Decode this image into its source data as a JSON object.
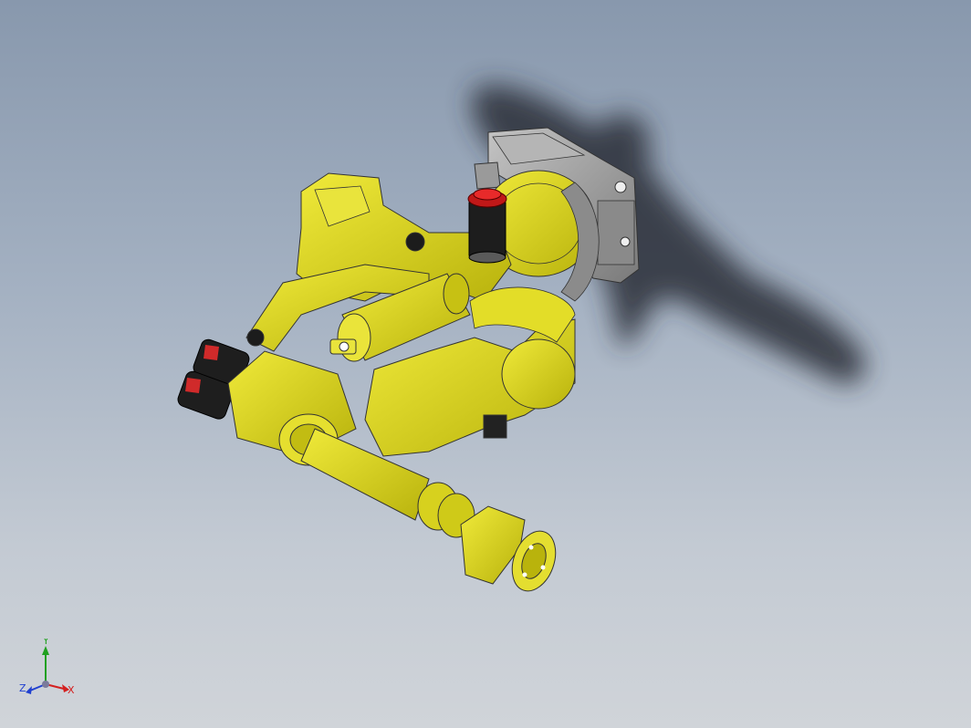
{
  "viewport": {
    "background_top": "#8898ad",
    "background_bottom": "#d0d4d9"
  },
  "model": {
    "body_color": "#d8d312",
    "shadow_color": "#2a2f37",
    "base_color": "#9c9c9c",
    "cap_color": "#d21a1a",
    "motor_color": "#222222"
  },
  "triad": {
    "x_label": "X",
    "y_label": "Y",
    "z_label": "Z",
    "x_color": "#d42020",
    "y_color": "#20a020",
    "z_color": "#2040d0"
  }
}
